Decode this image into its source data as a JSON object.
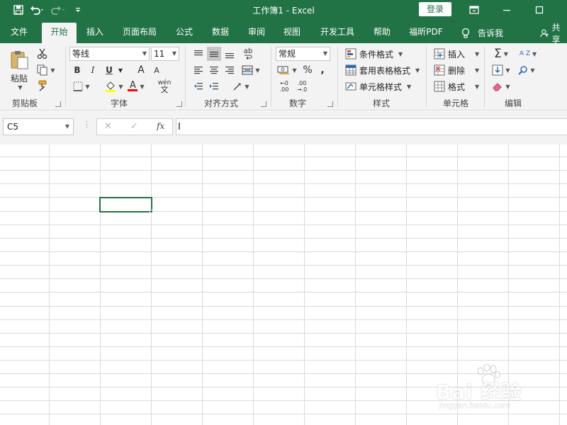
{
  "titlebar": {
    "title": "工作簿1  -  Excel",
    "login": "登录"
  },
  "tabs": [
    "文件",
    "开始",
    "插入",
    "页面布局",
    "公式",
    "数据",
    "审阅",
    "视图",
    "开发工具",
    "帮助",
    "福昕PDF"
  ],
  "active_tab": "开始",
  "tell_me": "告诉我",
  "share": "共享",
  "ribbon": {
    "clipboard": {
      "paste": "粘贴",
      "label": "剪贴板"
    },
    "font": {
      "name": "等线",
      "size": "11",
      "bold": "B",
      "italic": "I",
      "underline": "U",
      "grow": "A",
      "shrink": "A",
      "font_color_glyph": "A",
      "phonetic_top": "wén",
      "phonetic_bottom": "文",
      "label": "字体",
      "fill_color": "#FFFF00",
      "text_color": "#FF0000"
    },
    "alignment": {
      "label": "对齐方式",
      "wrap_glyph": "ab"
    },
    "number": {
      "format": "常规",
      "percent": "%",
      "comma": ",",
      "inc_top": "←0",
      "inc_bottom": ".00",
      "dec_top": ".00",
      "dec_bottom": "→.0",
      "label": "数字"
    },
    "styles": {
      "conditional": "条件格式",
      "table": "套用表格格式",
      "cell": "单元格样式",
      "label": "样式"
    },
    "cells": {
      "insert": "插入",
      "delete": "删除",
      "format": "格式",
      "label": "单元格"
    },
    "editing": {
      "sum_glyph": "Σ",
      "sort_glyph": "A Z",
      "label": "编辑"
    }
  },
  "formula_bar": {
    "name_box": "C5",
    "cancel_glyph": "✕",
    "enter_glyph": "✓",
    "fx_glyph": "fx",
    "value": ""
  },
  "grid": {
    "selected_cell": "C5"
  },
  "watermark": {
    "brand": "Bai 经验",
    "url": "jingyan.baidu.com"
  },
  "colors": {
    "excel_green": "#217346",
    "ribbon_bg": "#F3F3F3",
    "grid_line": "#DADADA"
  }
}
